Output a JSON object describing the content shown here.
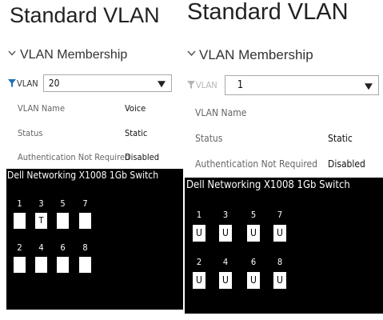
{
  "panels": [
    {
      "title": "Standard VLAN",
      "section": "VLAN Membership",
      "vlan_label": "VLAN",
      "vlan_selected": "20",
      "fields": [
        {
          "label": "VLAN Name",
          "value": "Voice"
        },
        {
          "label": "Status",
          "value": "Static"
        },
        {
          "label": "Authentication Not Required",
          "value": "Disabled"
        }
      ],
      "switch_name": "Dell Networking X1008 1Gb Switch",
      "ports": [
        {
          "num": "1",
          "state": ""
        },
        {
          "num": "3",
          "state": "T"
        },
        {
          "num": "5",
          "state": ""
        },
        {
          "num": "7",
          "state": ""
        },
        {
          "num": "2",
          "state": ""
        },
        {
          "num": "4",
          "state": ""
        },
        {
          "num": "6",
          "state": ""
        },
        {
          "num": "8",
          "state": ""
        }
      ]
    },
    {
      "title": "Standard VLAN",
      "section": "VLAN Membership",
      "vlan_label": "VLAN",
      "vlan_selected": "1",
      "fields": [
        {
          "label": "VLAN Name",
          "value": ""
        },
        {
          "label": "Status",
          "value": "Static"
        },
        {
          "label": "Authentication Not Required",
          "value": "Disabled"
        }
      ],
      "switch_name": "Dell Networking X1008 1Gb Switch",
      "ports": [
        {
          "num": "1",
          "state": "U"
        },
        {
          "num": "3",
          "state": "U"
        },
        {
          "num": "5",
          "state": "U"
        },
        {
          "num": "7",
          "state": "U"
        },
        {
          "num": "2",
          "state": "U"
        },
        {
          "num": "4",
          "state": "U"
        },
        {
          "num": "6",
          "state": "U"
        },
        {
          "num": "8",
          "state": "U"
        }
      ]
    }
  ],
  "colors": {
    "filter_active": "#1f6fb5",
    "filter_disabled": "#b5b5b5",
    "switch_bg": "#000000"
  },
  "icons": {
    "section_toggle": "chevron-down-icon",
    "vlan_filter": "filter-icon",
    "dropdown": "caret-down-icon"
  }
}
